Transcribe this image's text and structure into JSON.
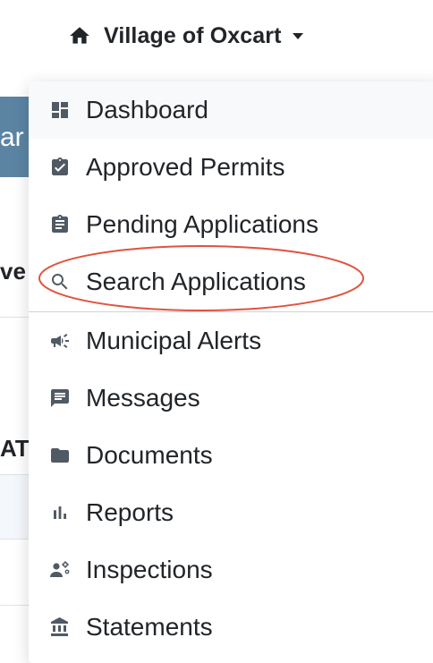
{
  "navbar": {
    "brand_label": "Village of Oxcart"
  },
  "background": {
    "banner_text": "ar",
    "column_text_1": "ve",
    "column_text_2": "AT"
  },
  "menu": {
    "items": [
      {
        "label": "Dashboard",
        "icon": "dashboard-icon",
        "active": true
      },
      {
        "label": "Approved Permits",
        "icon": "clipboard-check-icon"
      },
      {
        "label": "Pending Applications",
        "icon": "clipboard-list-icon"
      },
      {
        "label": "Search Applications",
        "icon": "search-icon",
        "highlighted": true
      },
      {
        "label": "Municipal Alerts",
        "icon": "megaphone-icon"
      },
      {
        "label": "Messages",
        "icon": "message-icon"
      },
      {
        "label": "Documents",
        "icon": "folder-icon"
      },
      {
        "label": "Reports",
        "icon": "bar-chart-icon"
      },
      {
        "label": "Inspections",
        "icon": "inspector-icon"
      },
      {
        "label": "Statements",
        "icon": "bank-icon"
      }
    ]
  },
  "colors": {
    "highlight_ellipse": "#e0533f",
    "icon": "#505a64",
    "banner": "#5b84a3"
  }
}
